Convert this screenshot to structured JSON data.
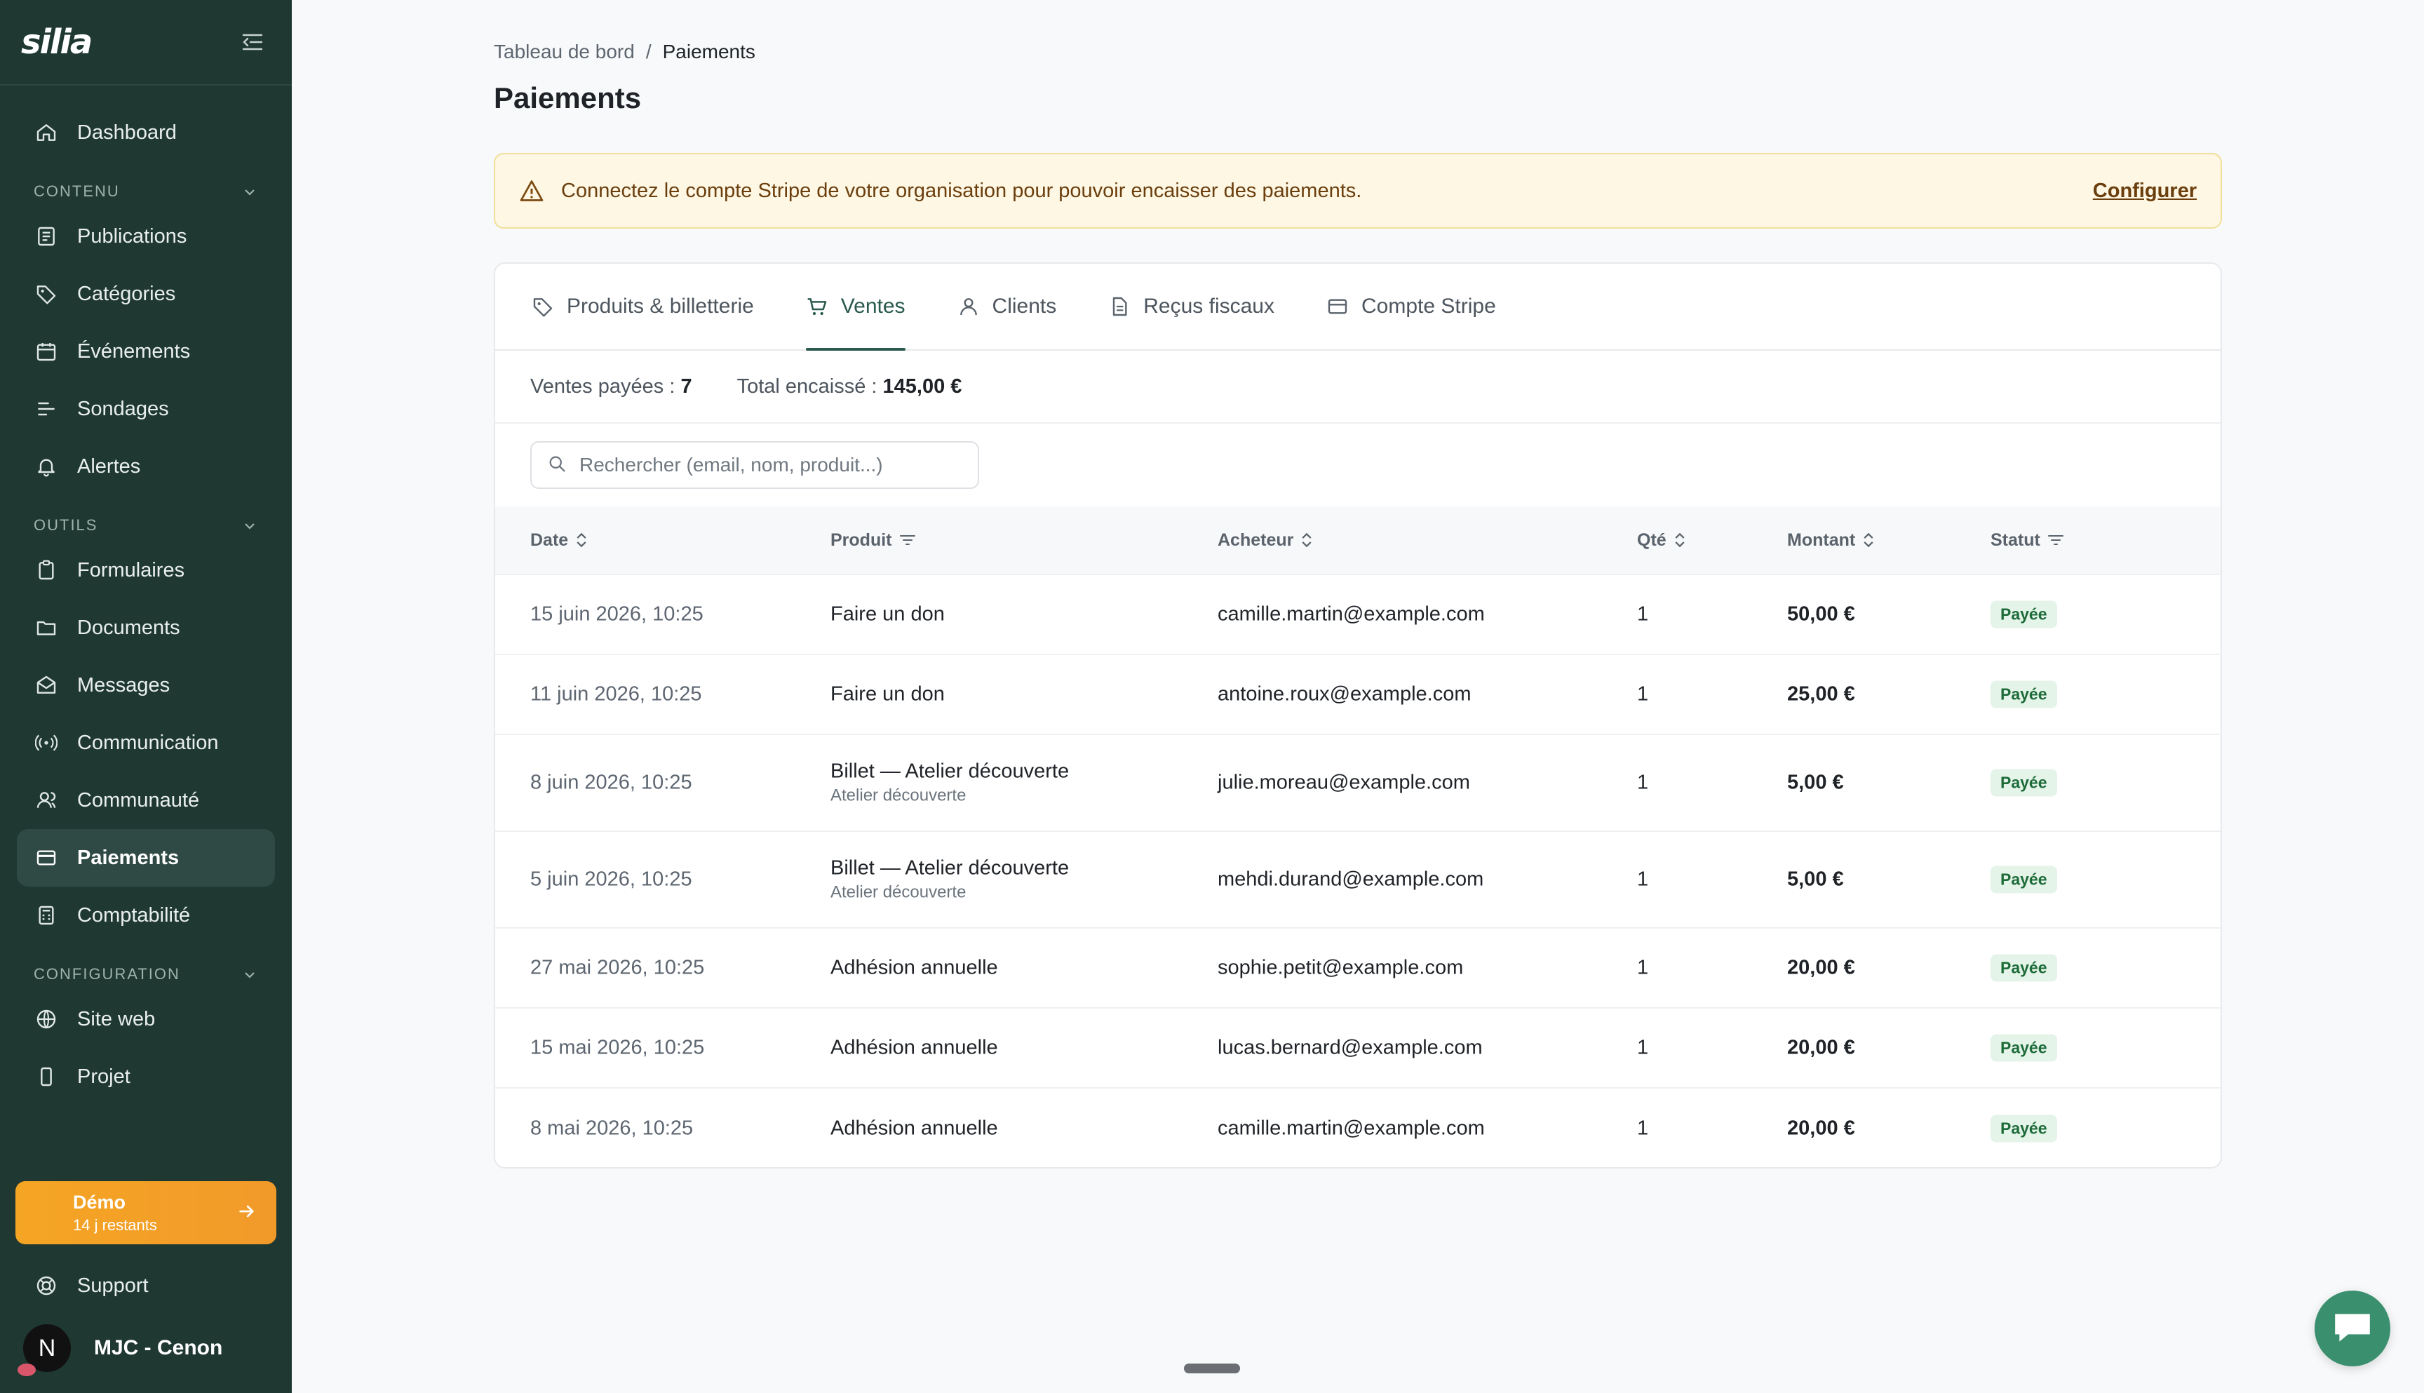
{
  "sidebar": {
    "logo": "silia",
    "dashboard": "Dashboard",
    "sections": {
      "contenu": "CONTENU",
      "outils": "OUTILS",
      "configuration": "CONFIGURATION"
    },
    "contenu_items": [
      {
        "label": "Publications",
        "icon": "newspaper-icon"
      },
      {
        "label": "Catégories",
        "icon": "tag-icon"
      },
      {
        "label": "Événements",
        "icon": "calendar-icon"
      },
      {
        "label": "Sondages",
        "icon": "bars-icon"
      },
      {
        "label": "Alertes",
        "icon": "bell-icon"
      }
    ],
    "outils_items": [
      {
        "label": "Formulaires",
        "icon": "clipboard-icon"
      },
      {
        "label": "Documents",
        "icon": "folder-icon"
      },
      {
        "label": "Messages",
        "icon": "mail-icon"
      },
      {
        "label": "Communication",
        "icon": "broadcast-icon"
      },
      {
        "label": "Communauté",
        "icon": "users-icon"
      },
      {
        "label": "Paiements",
        "icon": "card-icon",
        "active": true
      },
      {
        "label": "Comptabilité",
        "icon": "calculator-icon"
      }
    ],
    "config_items": [
      {
        "label": "Site web",
        "icon": "globe-icon"
      },
      {
        "label": "Projet",
        "icon": "phone-icon"
      }
    ],
    "trial": {
      "title": "Démo",
      "subtitle": "14 j restants"
    },
    "support": "Support",
    "avatar_letter": "N",
    "org_name": "MJC - Cenon"
  },
  "breadcrumb": {
    "parent": "Tableau de bord",
    "separator": "/",
    "current": "Paiements"
  },
  "page_title": "Paiements",
  "alert": {
    "message": "Connectez le compte Stripe de votre organisation pour pouvoir encaisser des paiements.",
    "action": "Configurer"
  },
  "tabs": [
    {
      "label": "Produits & billetterie",
      "icon": "tag-icon"
    },
    {
      "label": "Ventes",
      "icon": "cart-icon",
      "active": true
    },
    {
      "label": "Clients",
      "icon": "user-icon"
    },
    {
      "label": "Reçus fiscaux",
      "icon": "document-icon"
    },
    {
      "label": "Compte Stripe",
      "icon": "card-icon"
    }
  ],
  "stats": {
    "paid_label": "Ventes payées : ",
    "paid_value": "7",
    "total_label": "Total encaissé : ",
    "total_value": "145,00 €"
  },
  "search": {
    "placeholder": "Rechercher (email, nom, produit...)"
  },
  "table": {
    "headers": [
      "Date",
      "Produit",
      "Acheteur",
      "Qté",
      "Montant",
      "Statut"
    ],
    "rows": [
      {
        "date": "15 juin 2026, 10:25",
        "product": "Faire un don",
        "sub": "",
        "buyer": "camille.martin@example.com",
        "qty": "1",
        "amount": "50,00 €",
        "status": "Payée"
      },
      {
        "date": "11 juin 2026, 10:25",
        "product": "Faire un don",
        "sub": "",
        "buyer": "antoine.roux@example.com",
        "qty": "1",
        "amount": "25,00 €",
        "status": "Payée"
      },
      {
        "date": "8 juin 2026, 10:25",
        "product": "Billet — Atelier découverte",
        "sub": "Atelier découverte",
        "buyer": "julie.moreau@example.com",
        "qty": "1",
        "amount": "5,00 €",
        "status": "Payée"
      },
      {
        "date": "5 juin 2026, 10:25",
        "product": "Billet — Atelier découverte",
        "sub": "Atelier découverte",
        "buyer": "mehdi.durand@example.com",
        "qty": "1",
        "amount": "5,00 €",
        "status": "Payée"
      },
      {
        "date": "27 mai 2026, 10:25",
        "product": "Adhésion annuelle",
        "sub": "",
        "buyer": "sophie.petit@example.com",
        "qty": "1",
        "amount": "20,00 €",
        "status": "Payée"
      },
      {
        "date": "15 mai 2026, 10:25",
        "product": "Adhésion annuelle",
        "sub": "",
        "buyer": "lucas.bernard@example.com",
        "qty": "1",
        "amount": "20,00 €",
        "status": "Payée"
      },
      {
        "date": "8 mai 2026, 10:25",
        "product": "Adhésion annuelle",
        "sub": "",
        "buyer": "camille.martin@example.com",
        "qty": "1",
        "amount": "20,00 €",
        "status": "Payée"
      }
    ]
  },
  "colors": {
    "sidebar": "#1f3832",
    "accent": "#2b5a4f",
    "trial": "#f5a524",
    "alert_bg": "#fdf7e3",
    "badge_bg": "#e4f4e8"
  }
}
